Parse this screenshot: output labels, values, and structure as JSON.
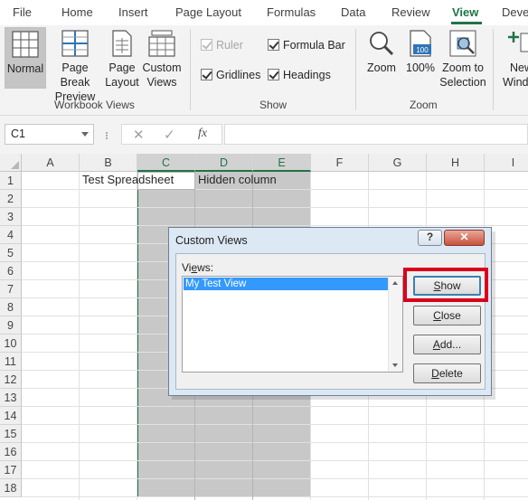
{
  "menu_tabs": [
    {
      "label": "File"
    },
    {
      "label": "Home"
    },
    {
      "label": "Insert"
    },
    {
      "label": "Page Layout"
    },
    {
      "label": "Formulas"
    },
    {
      "label": "Data"
    },
    {
      "label": "Review"
    },
    {
      "label": "View",
      "active": true
    },
    {
      "label": "Deve"
    }
  ],
  "ribbon": {
    "workbook_views": {
      "label": "Workbook Views",
      "buttons": [
        {
          "label_1": "Normal",
          "label_2": "",
          "icon": "normal-view-icon",
          "selected": true
        },
        {
          "label_1": "Page Break",
          "label_2": "Preview",
          "icon": "page-break-preview-icon"
        },
        {
          "label_1": "Page",
          "label_2": "Layout",
          "icon": "page-layout-icon"
        },
        {
          "label_1": "Custom",
          "label_2": "Views",
          "icon": "custom-views-icon"
        }
      ]
    },
    "show": {
      "label": "Show",
      "ruler": "Ruler",
      "gridlines": "Gridlines",
      "formula_bar": "Formula Bar",
      "headings": "Headings"
    },
    "zoom": {
      "label": "Zoom",
      "zoom_btn": "Zoom",
      "hundred_1": "100%",
      "hundred_icon_text": "100",
      "selection_1": "Zoom to",
      "selection_2": "Selection"
    },
    "new_window": {
      "label_1": "New",
      "label_2": "Windo"
    }
  },
  "formula_bar": {
    "name_box": "C1",
    "cancel": "✕",
    "enter": "✓",
    "fx": "fx",
    "value": ""
  },
  "sheet": {
    "columns": [
      "A",
      "B",
      "C",
      "D",
      "E",
      "F",
      "G",
      "H",
      "I"
    ],
    "rows": [
      "1",
      "2",
      "3",
      "4",
      "5",
      "6",
      "7",
      "8",
      "9",
      "10",
      "11",
      "12",
      "13",
      "14",
      "15",
      "16",
      "17",
      "18"
    ],
    "selected_columns": [
      "C",
      "D",
      "E"
    ],
    "active_cell": "C1",
    "cells": {
      "B1": "Test Spreadsheet",
      "D1": "Hidden column"
    }
  },
  "dialog": {
    "title": "Custom Views",
    "help_button": "?",
    "close_button": "✕",
    "views_label_pre": "Vi",
    "views_label_u": "e",
    "views_label_post": "ws:",
    "views": [
      "My Test View"
    ],
    "selected_view": "My Test View",
    "buttons": {
      "show": {
        "pre": "",
        "u": "S",
        "post": "how"
      },
      "close": {
        "pre": "",
        "u": "C",
        "post": "lose"
      },
      "add": {
        "pre": "",
        "u": "A",
        "post": "dd..."
      },
      "delete": {
        "pre": "",
        "u": "D",
        "post": "elete"
      }
    },
    "highlighted_button": "show",
    "highlight_color": "#d9001b"
  },
  "colors": {
    "accent": "#217346",
    "selection_fill": "#c8c8c8",
    "list_selection": "#3399ff"
  }
}
